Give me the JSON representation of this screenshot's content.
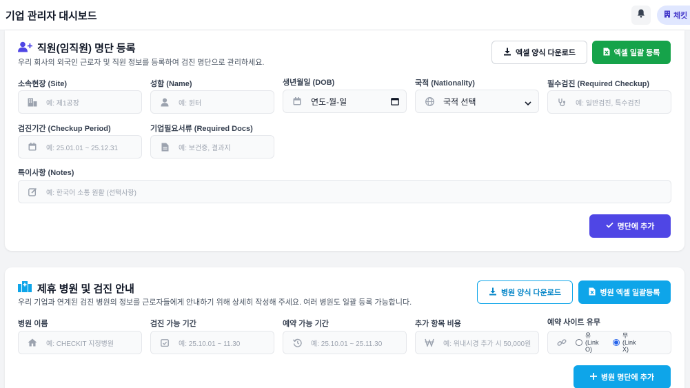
{
  "header": {
    "title": "기업 관리자 대시보드",
    "user_chip": "체킷"
  },
  "employee": {
    "title": "직원(임직원) 명단 등록",
    "desc": "우리 회사의 외국인 근로자 및 직원 정보를 등록하여 검진 명단으로 관리하세요.",
    "download_btn": "엑셀 양식 다운로드",
    "upload_btn": "엑셀 일괄 등록",
    "fields": {
      "site": {
        "label": "소속현장 (Site)",
        "placeholder": "예: 제1공장"
      },
      "name": {
        "label": "성함 (Name)",
        "placeholder": "예: 윈터"
      },
      "dob": {
        "label": "생년월일 (DOB)",
        "value": "연도-월-일"
      },
      "nationality": {
        "label": "국적 (Nationality)",
        "value": "국적 선택"
      },
      "checkup": {
        "label": "필수검진 (Required Checkup)",
        "placeholder": "예: 일반검진, 특수검진"
      },
      "period": {
        "label": "검진기간 (Checkup Period)",
        "placeholder": "예: 25.01.01 ~ 25.12.31"
      },
      "docs": {
        "label": "기업필요서류 (Required Docs)",
        "placeholder": "예: 보건증, 결과지"
      },
      "notes": {
        "label": "특이사항 (Notes)",
        "placeholder": "예: 한국어 소통 원활 (선택사항)"
      }
    },
    "add_btn": "명단에 추가"
  },
  "hospital": {
    "title": "제휴 병원 및 검진 안내",
    "desc": "우리 기업과 연계된 검진 병원의 정보를 근로자들에게 안내하기 위해 상세히 작성해 주세요. 여러 병원도 일괄 등록 가능합니다.",
    "download_btn": "병원 양식 다운로드",
    "upload_btn": "병원 엑셀 일괄등록",
    "fields": {
      "name": {
        "label": "병원 이름",
        "placeholder": "예: CHECKIT 지정병원"
      },
      "checkup_period": {
        "label": "검진 가능 기간",
        "placeholder": "예: 25.10.01 ~ 11.30"
      },
      "reserve_period": {
        "label": "예약 가능 기간",
        "placeholder": "예: 25.10.01 ~ 25.11.30"
      },
      "cost": {
        "label": "추가 항목 비용",
        "placeholder": "예: 위내시경 추가 시 50,000원"
      },
      "site": {
        "label": "예약 사이트 유무",
        "opt_yes": "유 (Link O)",
        "opt_no": "무 (Link X)"
      }
    },
    "add_btn": "병원 명단에 추가"
  }
}
